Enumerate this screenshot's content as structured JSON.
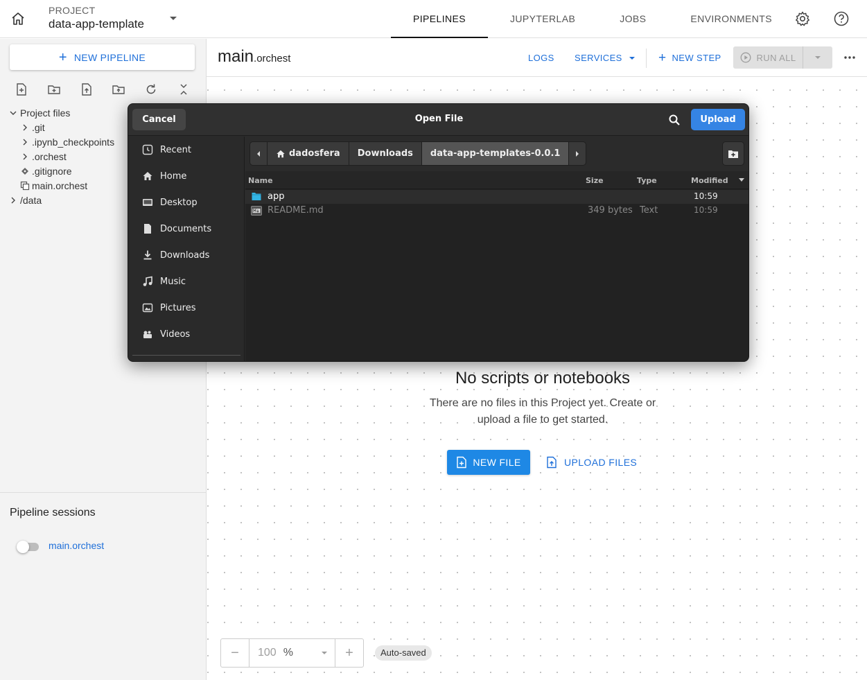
{
  "topbar": {
    "project_label": "PROJECT",
    "project_name": "data-app-template",
    "tabs": [
      "PIPELINES",
      "JUPYTERLAB",
      "JOBS",
      "ENVIRONMENTS"
    ],
    "active_tab": "PIPELINES"
  },
  "sidebar": {
    "new_pipeline": "NEW PIPELINE",
    "tree": {
      "root": "Project files",
      "items": [
        ".git",
        ".ipynb_checkpoints",
        ".orchest",
        ".gitignore",
        "main.orchest"
      ],
      "data": "/data"
    },
    "sessions_title": "Pipeline sessions",
    "session_name": "main.orchest"
  },
  "main": {
    "title_name": "main",
    "title_ext": ".orchest",
    "logs": "LOGS",
    "services": "SERVICES",
    "new_step": "NEW STEP",
    "run_all": "RUN ALL",
    "empty_heading": "No scripts or notebooks",
    "empty_line1": "There are no files in this Project yet. Create or",
    "empty_line2": "upload a file to get started.",
    "new_file": "NEW FILE",
    "upload_files": "UPLOAD FILES",
    "zoom_value": "100",
    "zoom_unit": "%",
    "auto_saved": "Auto-saved"
  },
  "dialog": {
    "cancel": "Cancel",
    "title": "Open File",
    "upload": "Upload",
    "places": [
      "Recent",
      "Home",
      "Desktop",
      "Documents",
      "Downloads",
      "Music",
      "Pictures",
      "Videos"
    ],
    "crumbs": [
      "dadosfera",
      "Downloads",
      "data-app-templates-0.0.1"
    ],
    "columns": {
      "name": "Name",
      "size": "Size",
      "type": "Type",
      "modified": "Modified"
    },
    "files": [
      {
        "name": "app",
        "size": "",
        "type": "",
        "modified": "10:59",
        "kind": "folder"
      },
      {
        "name": "README.md",
        "size": "349 bytes",
        "type": "Text",
        "modified": "10:59",
        "kind": "file"
      }
    ]
  },
  "colors": {
    "accent": "#1e6fd9",
    "primary_button": "#1e88e5",
    "dialog_bg": "#2b2b2b",
    "gtk_blue": "#3584e4",
    "folder": "#33b5e5"
  }
}
